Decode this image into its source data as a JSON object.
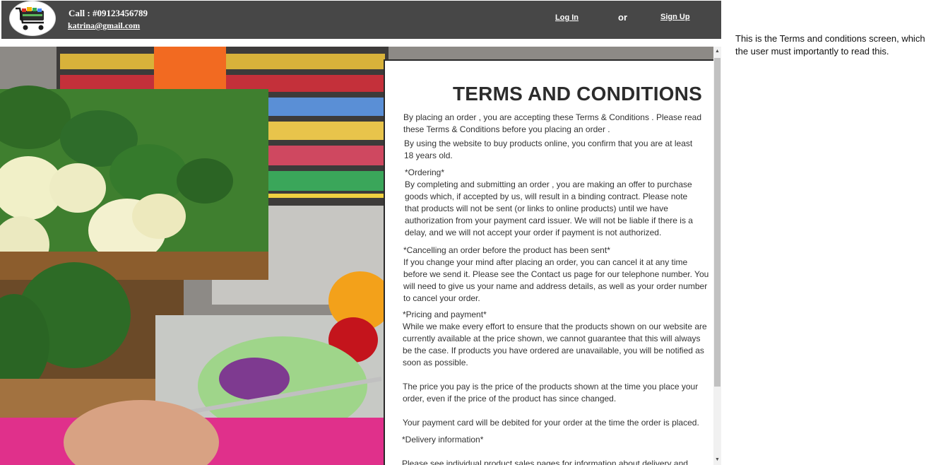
{
  "header": {
    "phone": "Call : #09123456789",
    "email": "katrina@gmail.com",
    "login_label": "Log In",
    "or_label": "or",
    "signup_label": "Sign Up"
  },
  "terms": {
    "title": "TERMS AND CONDITIONS",
    "p1": "By placing an order , you are accepting these Terms & Conditions . Please read\nthese Terms & Conditions before you placing an order .",
    "p2": "By using the website to buy products online, you confirm that you are at least\n18 years old.",
    "ordering_heading": "*Ordering*",
    "ordering_body": "By completing and submitting an order , you are making an offer to purchase\ngoods which, if accepted by us, will result in a binding contract. Please note\nthat products will not be sent (or links to online products) until we have\nauthorization from your payment card issuer. We will not be liable if there is a\ndelay, and we will not accept your order if payment is not authorized.",
    "cancel_heading": "*Cancelling an order before the product has been sent*",
    "cancel_body": "If you change your mind after placing an order, you can cancel it at any time\nbefore we send it. Please see the Contact us page for our telephone number. You\nwill need to give us your name and address details, as well as your order number\nto cancel your order.",
    "pricing_heading": "*Pricing and payment*",
    "pricing_body": "While we make every effort to ensure that the products shown on our website are\ncurrently available at the price shown, we cannot guarantee that this will always\nbe the case. If products you have ordered are unavailable, you will be notified as\nsoon as possible.",
    "pricing_body2": "The price you pay is the price of the products shown at the time you place your\norder, even if the price of the product has since changed.",
    "pricing_body3": "Your payment card will be debited for your order at the time the order is placed.",
    "delivery_heading": "*Delivery information*",
    "delivery_body": "Please see individual product sales pages for information about delivery and"
  },
  "side_note": "This is the Terms and conditions screen, which the user must importantly to read this.",
  "icons": {
    "logo": "shopping-cart-logo",
    "scroll_up": "scroll-up-arrow",
    "scroll_down": "scroll-down-arrow"
  }
}
